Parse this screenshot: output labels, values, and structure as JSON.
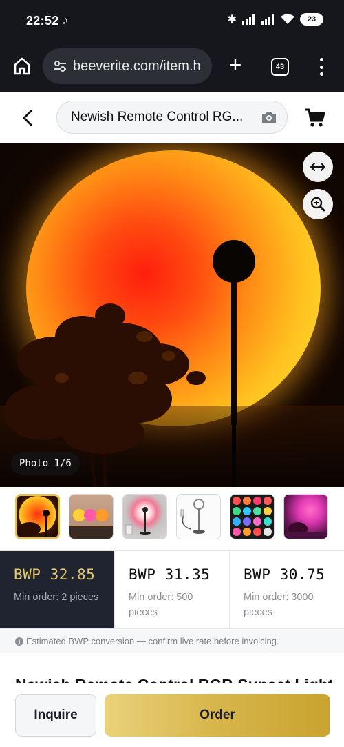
{
  "status_bar": {
    "time": "22:52",
    "battery": "23"
  },
  "browser": {
    "url": "beeverite.com/item.h",
    "tab_count": "43"
  },
  "header": {
    "search_text": "Newish Remote Control RG..."
  },
  "gallery": {
    "counter": "Photo 1/6",
    "thumbnail_count": 6
  },
  "price_tiers": [
    {
      "price": "BWP  32.85",
      "min_order": "Min order: 2 pieces",
      "selected": true
    },
    {
      "price": "BWP  31.35",
      "min_order": "Min order: 500 pieces",
      "selected": false
    },
    {
      "price": "BWP  30.75",
      "min_order": "Min order: 3000 pieces",
      "selected": false
    }
  ],
  "conversion_note": "Estimated BWP conversion — confirm live rate before invoicing.",
  "product_title": "Newish Remote Control RGB Sunset Light",
  "actions": {
    "inquire": "Inquire",
    "order": "Order"
  },
  "colors": {
    "accent_gold": "#d6b54a",
    "selected_tier_bg": "#1f2430",
    "status_bar_bg": "#15171c"
  }
}
